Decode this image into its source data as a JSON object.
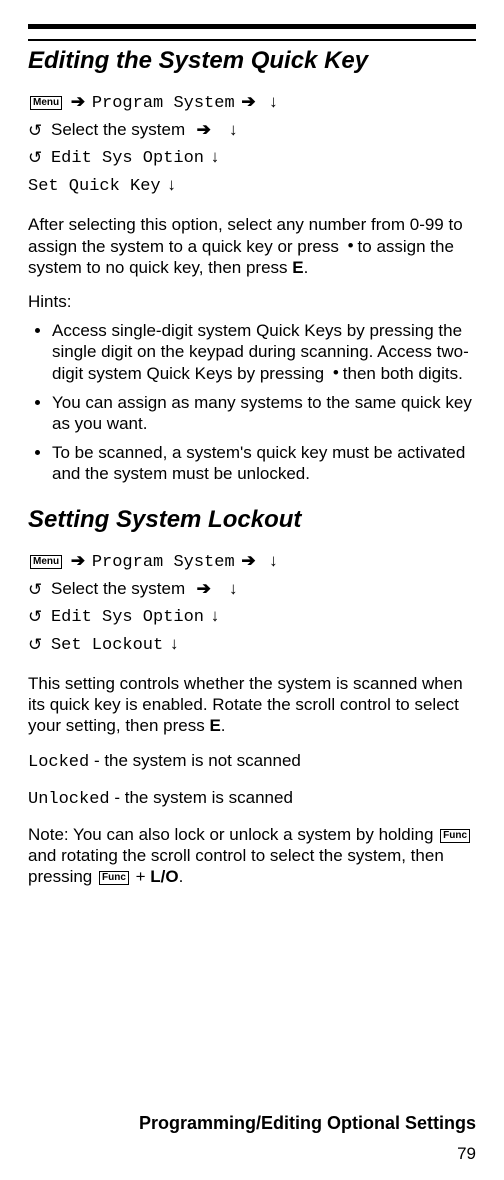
{
  "section1": {
    "title": "Editing the System Quick Key",
    "nav": {
      "menu_key": "Menu",
      "program_system": "Program System",
      "select_system": "Select the system",
      "edit_sys_option": "Edit Sys Option",
      "set_quick_key": "Set Quick Key"
    },
    "body_part1": "After selecting this option, select any number from 0-99 to assign the system to a quick key or press",
    "body_part2": "to assign the system to no quick key, then press",
    "body_key_E": "E",
    "body_part3": ".",
    "hints_label": "Hints:",
    "bullets": [
      {
        "pre": "Access single-digit system Quick Keys by pressing the single digit on the keypad during scanning. Access two-digit system Quick Keys by pressing",
        "post": "then both digits."
      },
      {
        "full": "You can assign as many systems to the same quick key as you want."
      },
      {
        "full": "To be scanned, a system's quick key must be activated and the system must be unlocked."
      }
    ]
  },
  "section2": {
    "title": "Setting System Lockout",
    "nav": {
      "menu_key": "Menu",
      "program_system": "Program System",
      "select_system": "Select the system",
      "edit_sys_option": "Edit Sys Option",
      "set_lockout": "Set Lockout"
    },
    "body1": "This setting controls whether the system is scanned when its quick key is enabled. Rotate the scroll control to select your setting, then press",
    "body1_key_E": "E",
    "body1_suffix": ".",
    "locked_label": "Locked",
    "locked_desc": " - the system is not scanned",
    "unlocked_label": "Unlocked",
    "unlocked_desc": " - the system is scanned",
    "note_pre": "Note: You can also lock or unlock a system by holding",
    "func_key": "Func",
    "note_mid": "and rotating the scroll control to select the system, then pressing",
    "note_plus": " + ",
    "note_lo": "L/O",
    "note_suffix": "."
  },
  "footer": {
    "title": "Programming/Editing Optional Settings",
    "page_num": "79"
  },
  "icons": {
    "right_arrow": "➔",
    "down_arrow": "↓",
    "rotate": "↺",
    "dot": "•"
  }
}
